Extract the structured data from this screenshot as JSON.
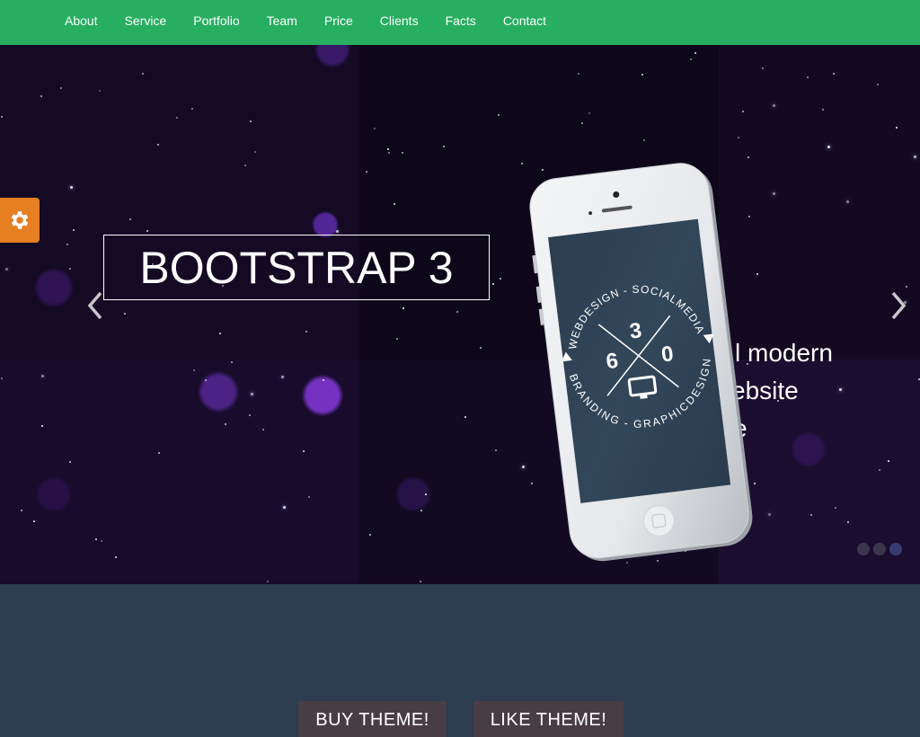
{
  "nav": {
    "items": [
      {
        "label": "About"
      },
      {
        "label": "Service"
      },
      {
        "label": "Portfolio"
      },
      {
        "label": "Team"
      },
      {
        "label": "Price"
      },
      {
        "label": "Clients"
      },
      {
        "label": "Facts"
      },
      {
        "label": "Contact"
      }
    ]
  },
  "settings": {
    "icon": "gear-icon"
  },
  "slider": {
    "title": "BOOTSTRAP 3",
    "caption_lines": [
      "l modern",
      "ebsite",
      "e"
    ],
    "prev_icon": "chevron-left-icon",
    "next_icon": "chevron-right-icon",
    "indicator_count": 3,
    "active_indicator": 3,
    "phone_screen": {
      "top_arc": "WEBDESIGN - SOCIALMEDIA",
      "bottom_arc": "BRANDING - GRAPHICDESIGN",
      "digits": [
        "3",
        "6",
        "0"
      ]
    }
  },
  "cta": {
    "buy_label": "BUY THEME!",
    "like_label": "LIKE THEME!"
  },
  "colors": {
    "nav_bg": "#27ae60",
    "settings_bg": "#e67e22",
    "section_bg": "#2c3e50",
    "button_bg": "#483d44"
  }
}
